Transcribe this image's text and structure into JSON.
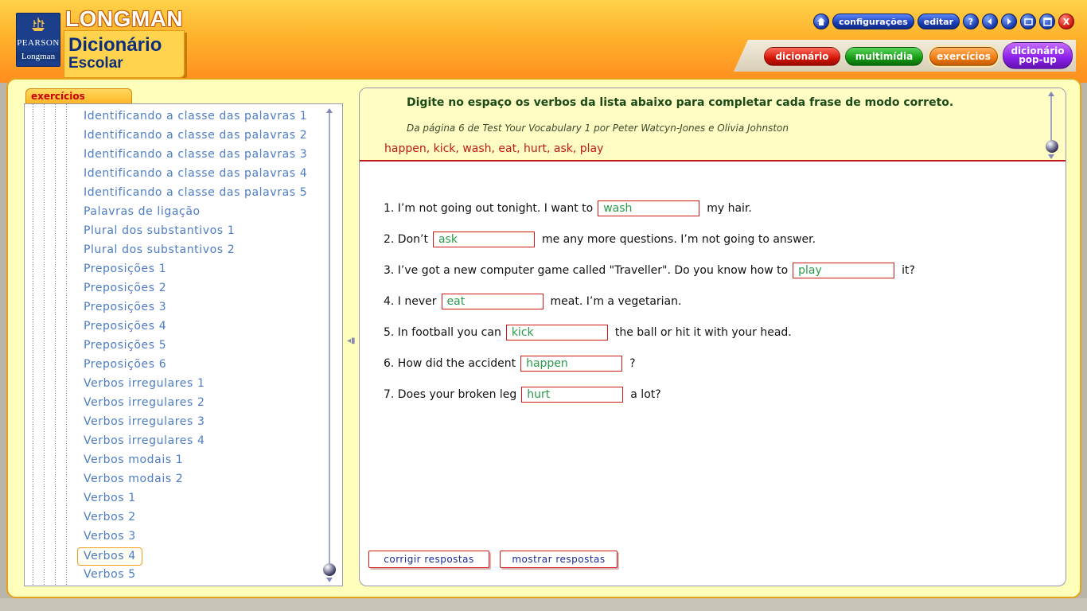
{
  "brand": {
    "publisher_top": "PEARSON",
    "publisher_bottom": "Longman",
    "title": "LONGMAN",
    "product_line1": "Dicionário",
    "product_line2": "Escolar"
  },
  "toolbar": {
    "home_icon": "home-icon",
    "settings_label": "configurações",
    "edit_label": "editar",
    "help_label": "?",
    "close_label": "X"
  },
  "nav": {
    "dicionario": "dicionário",
    "multimidia": "multimídia",
    "exercicios": "exercícios",
    "popup_line1": "dicionário",
    "popup_line2": "pop-up"
  },
  "sidebar": {
    "tab_label": "exercícios",
    "items": [
      "Identificando a classe das palavras 1",
      "Identificando a classe das palavras 2",
      "Identificando a classe das palavras 3",
      "Identificando a classe das palavras 4",
      "Identificando a classe das palavras 5",
      "Palavras de ligação",
      "Plural dos substantivos 1",
      "Plural dos substantivos 2",
      "Preposições 1",
      "Preposições 2",
      "Preposições 3",
      "Preposições 4",
      "Preposições 5",
      "Preposições 6",
      "Verbos irregulares 1",
      "Verbos irregulares 2",
      "Verbos irregulares 3",
      "Verbos irregulares 4",
      "Verbos modais 1",
      "Verbos modais 2",
      "Verbos 1",
      "Verbos 2",
      "Verbos 3",
      "Verbos 4",
      "Verbos 5"
    ],
    "selected": "Verbos 4"
  },
  "exercise": {
    "instruction": "Digite no espaço os verbos da lista abaixo para completar cada frase de modo correto.",
    "source": "Da página 6 de Test Your Vocabulary 1 por Peter Watcyn-Jones e Olivia Johnston",
    "word_list": "happen, kick, wash, eat, hurt, ask, play",
    "questions": [
      {
        "before": "1. I’m not going out tonight. I want to",
        "answer": "wash",
        "after": "my hair."
      },
      {
        "before": "2. Don’t",
        "answer": "ask",
        "after": "me any more questions. I’m not going to answer."
      },
      {
        "before": "3. I’ve got a new computer game called \"Traveller\". Do you know how to",
        "answer": "play",
        "after": "it?"
      },
      {
        "before": "4. I never",
        "answer": "eat",
        "after": "meat. I’m a vegetarian."
      },
      {
        "before": "5. In football you can",
        "answer": "kick",
        "after": "the ball or hit it with your head."
      },
      {
        "before": "6. How did the accident",
        "answer": "happen",
        "after": "?"
      },
      {
        "before": "7. Does your broken leg",
        "answer": "hurt",
        "after": "a lot?"
      }
    ],
    "check_button": "corrigir respostas",
    "show_button": "mostrar respostas"
  },
  "colors": {
    "accent_orange": "#ffb22c",
    "link_blue": "#4c7cc4",
    "answer_green": "#2a9a4a",
    "border_red": "#d01818"
  }
}
